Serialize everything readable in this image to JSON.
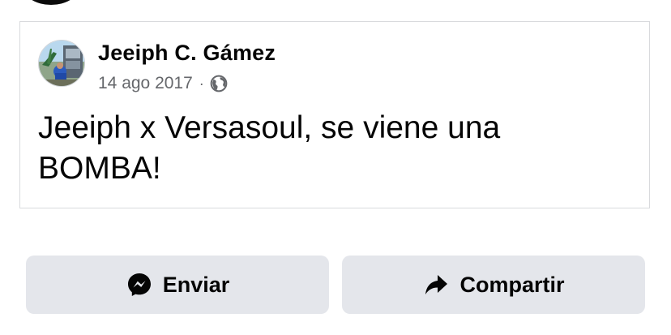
{
  "post": {
    "author_name": "Jeeiph C. Gámez",
    "date": "14 ago 2017",
    "separator": "·",
    "privacy_icon": "globe-icon",
    "text": "Jeeiph x Versasoul, se viene una BOMBA!"
  },
  "actions": {
    "send_label": "Enviar",
    "send_icon": "messenger-icon",
    "share_label": "Compartir",
    "share_icon": "share-arrow-icon"
  },
  "colors": {
    "primary_text": "#050505",
    "secondary_text": "#65676b",
    "button_background": "#e4e6eb",
    "card_border": "#d9dadd"
  }
}
